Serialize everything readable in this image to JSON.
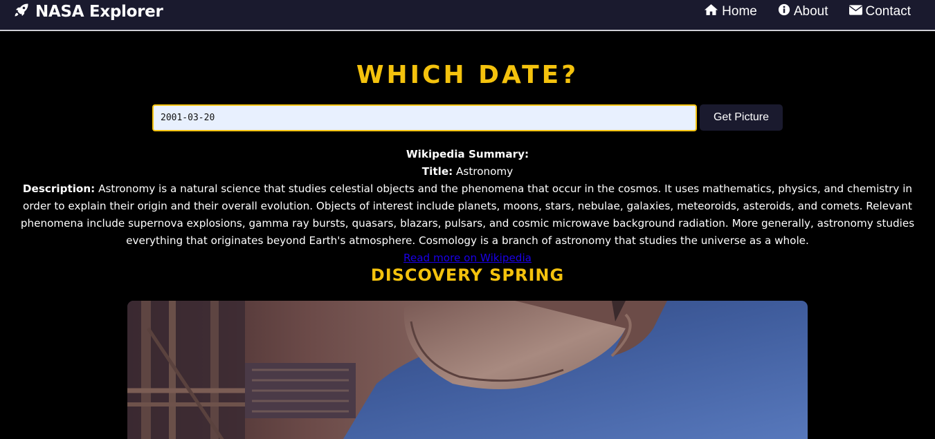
{
  "app": {
    "brand": "NASA Explorer",
    "brand_icon": "rocket-icon"
  },
  "nav": {
    "items": [
      {
        "label": "Home",
        "icon": "home-icon"
      },
      {
        "label": "About",
        "icon": "info-icon"
      },
      {
        "label": "Contact",
        "icon": "envelope-icon"
      }
    ]
  },
  "main": {
    "heading": "WHICH DATE?",
    "date_value": "2001-03-20",
    "button_label": "Get Picture"
  },
  "wikipedia": {
    "summary_label": "Wikipedia Summary:",
    "title_label": "Title:",
    "title": "Astronomy",
    "description_label": "Description:",
    "description": "Astronomy is a natural science that studies celestial objects and the phenomena that occur in the cosmos. It uses mathematics, physics, and chemistry in order to explain their origin and their overall evolution. Objects of interest include planets, moons, stars, nebulae, galaxies, meteoroids, asteroids, and comets. Relevant phenomena include supernova explosions, gamma ray bursts, quasars, blazars, pulsars, and cosmic microwave background radiation. More generally, astronomy studies everything that originates beyond Earth's atmosphere. Cosmology is a branch of astronomy that studies the universe as a whole.",
    "link_text": "Read more on Wikipedia"
  },
  "apod": {
    "title": "DISCOVERY SPRING"
  },
  "colors": {
    "accent": "#f4c20d",
    "navbar": "#1a1a2e",
    "background": "#000000",
    "link": "#1a00e8"
  }
}
